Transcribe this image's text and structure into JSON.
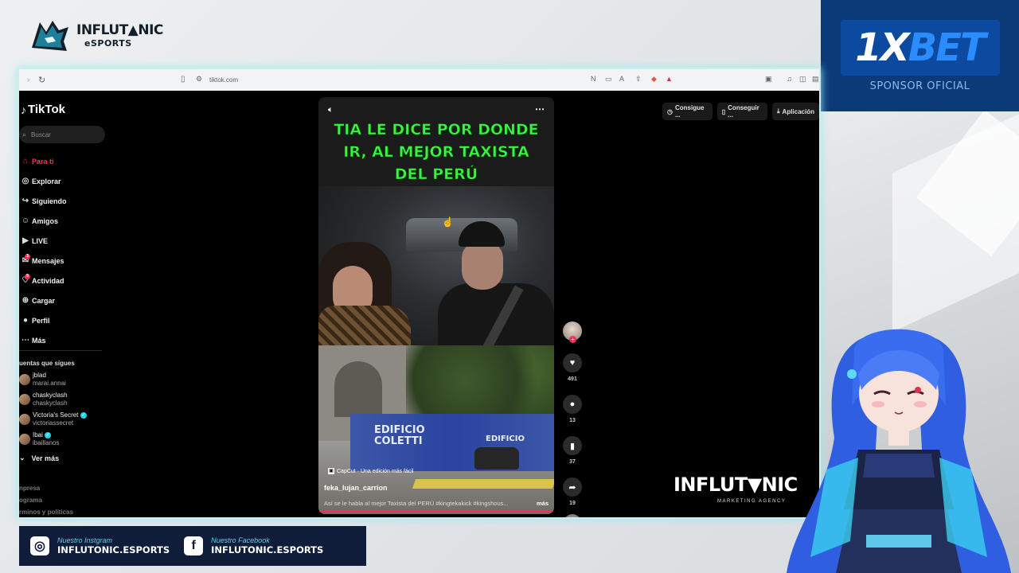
{
  "overlay": {
    "brand_line1": "INFLUT▲NIC",
    "brand_line2": "eSPORTS",
    "sponsor_logo_prefix": "1X",
    "sponsor_logo_suffix": "BET",
    "sponsor_sub": "SPONSOR OFICIAL",
    "watermark": "INFLUT▼NIC",
    "watermark_sub": "MARKETING AGENCY",
    "social": {
      "instagram_label": "Nuestro Instgram",
      "instagram_handle": "INFLUTONIC.ESPORTS",
      "facebook_label": "Nuestro Facebook",
      "facebook_handle": "INFLUTONIC.ESPORTS"
    }
  },
  "browser": {
    "url": "tiktok.com"
  },
  "tiktok": {
    "logo": "TikTok",
    "search_placeholder": "Buscar",
    "nav": [
      {
        "label": "Para ti",
        "icon": "home-icon"
      },
      {
        "label": "Explorar",
        "icon": "compass-icon"
      },
      {
        "label": "Siguiendo",
        "icon": "following-icon"
      },
      {
        "label": "Amigos",
        "icon": "friends-icon"
      },
      {
        "label": "LIVE",
        "icon": "live-icon"
      },
      {
        "label": "Mensajes",
        "icon": "messages-icon",
        "badge": "3"
      },
      {
        "label": "Actividad",
        "icon": "activity-icon",
        "badge": "9"
      },
      {
        "label": "Cargar",
        "icon": "upload-icon"
      },
      {
        "label": "Perfil",
        "icon": "profile-icon"
      },
      {
        "label": "Más",
        "icon": "more-icon"
      }
    ],
    "following_title": "uentas que sigues",
    "following": [
      {
        "name": "jblad",
        "handle": "marai.annai"
      },
      {
        "name": "chaskyclash",
        "handle": "chaskyclash"
      },
      {
        "name": "Victoria's Secret",
        "handle": "victoriassecret",
        "verified": true
      },
      {
        "name": "Ibai",
        "handle": "ibaillanos",
        "verified": true
      }
    ],
    "see_more": "Ver más",
    "footer": [
      "npresa",
      "ograma",
      "rminos y políticas"
    ],
    "top_right": [
      "Consigue ...",
      "Conseguir ...",
      "Aplicación"
    ],
    "video": {
      "headline_lines": [
        "TIA LE DICE POR DONDE",
        "IR, AL MEJOR TAXISTA",
        "DEL PERÚ"
      ],
      "hoarding_text_1": "EDIFICIO",
      "hoarding_text_2": "COLETTI",
      "hoarding_text_3": "EDIFICIO",
      "capcut": "CapCut · Una edición más fácil",
      "author": "feka_lujan_carrion",
      "description": "Así se le habla al mejor Taxista del PERÚ #kingtekakick #kingshous...",
      "more": "más"
    },
    "actions": {
      "likes": "491",
      "comments": "13",
      "saves": "37",
      "shares": "19"
    }
  }
}
